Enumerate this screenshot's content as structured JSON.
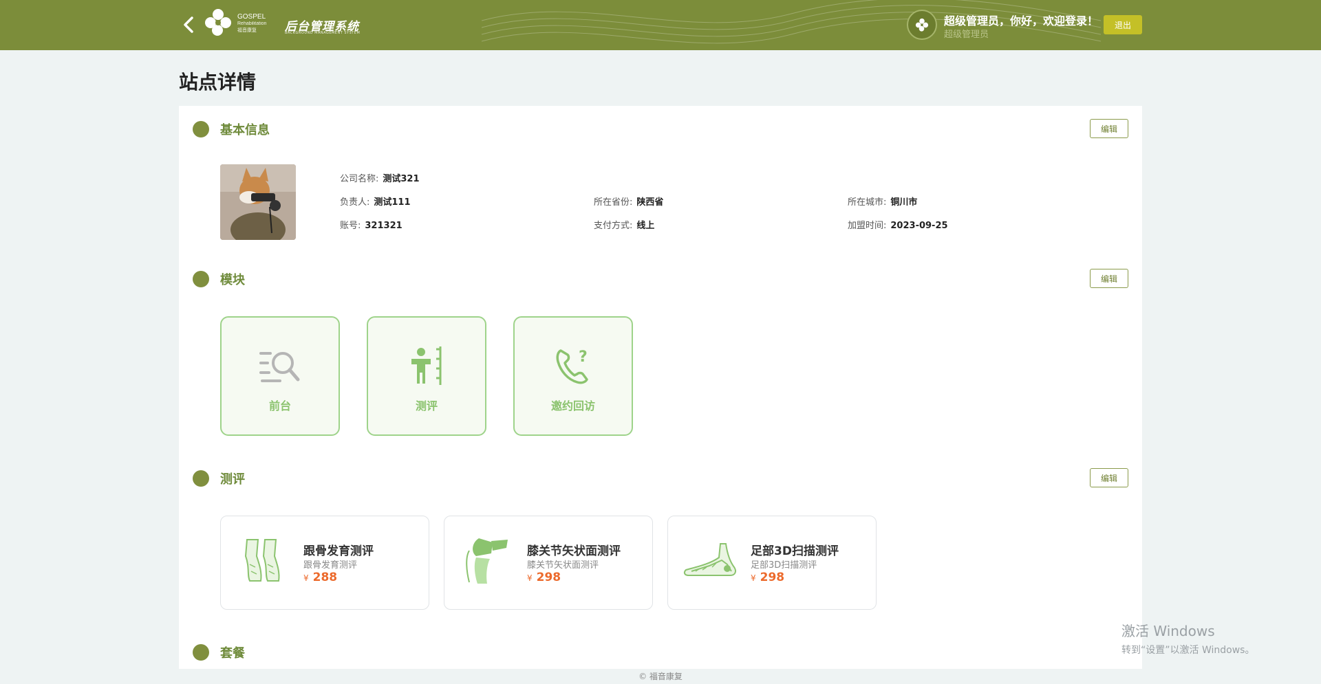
{
  "header": {
    "logo_brand": "GOSPEL",
    "logo_sub": "Rehabilitation",
    "logo_cn": "福音康复",
    "system_title": "后台管理系统",
    "system_sub": "BACKGROUND MANAGEMENT SYSTEM",
    "welcome": "超级管理员，你好，欢迎登录！",
    "role": "超级管理员",
    "logout_label": "退出"
  },
  "page_title": "站点详情",
  "sections": {
    "basic": {
      "title": "基本信息",
      "edit_label": "编辑"
    },
    "modules": {
      "title": "模块",
      "edit_label": "编辑"
    },
    "evaluations": {
      "title": "测评",
      "edit_label": "编辑"
    },
    "packages": {
      "title": "套餐"
    }
  },
  "basic_info": {
    "company_label": "公司名称:",
    "company_value": "测试321",
    "owner_label": "负责人:",
    "owner_value": "测试111",
    "province_label": "所在省份:",
    "province_value": "陕西省",
    "city_label": "所在城市:",
    "city_value": "铜川市",
    "account_label": "账号:",
    "account_value": "321321",
    "payment_label": "支付方式:",
    "payment_value": "线上",
    "join_label": "加盟时间:",
    "join_value": "2023-09-25"
  },
  "modules": [
    {
      "label": "前台",
      "icon": "search-list-icon"
    },
    {
      "label": "测评",
      "icon": "person-ruler-icon"
    },
    {
      "label": "邀约回访",
      "icon": "phone-question-icon"
    }
  ],
  "evaluations": [
    {
      "name": "跟骨发育测评",
      "desc": "跟骨发育测评",
      "currency": "¥",
      "price": "288",
      "icon": "heel-bone-icon"
    },
    {
      "name": "膝关节矢状面测评",
      "desc": "膝关节矢状面测评",
      "currency": "¥",
      "price": "298",
      "icon": "knee-joint-icon"
    },
    {
      "name": "足部3D扫描测评",
      "desc": "足部3D扫描测评",
      "currency": "¥",
      "price": "298",
      "icon": "foot-scan-icon"
    }
  ],
  "footer": "© 福音康复",
  "watermark": {
    "line1": "激活 Windows",
    "line2": "转到“设置”以激活 Windows。"
  },
  "colors": {
    "header": "#7c8d3a",
    "accent": "#808f3e",
    "module_green": "#8bc36e",
    "price": "#ec6a2c"
  }
}
